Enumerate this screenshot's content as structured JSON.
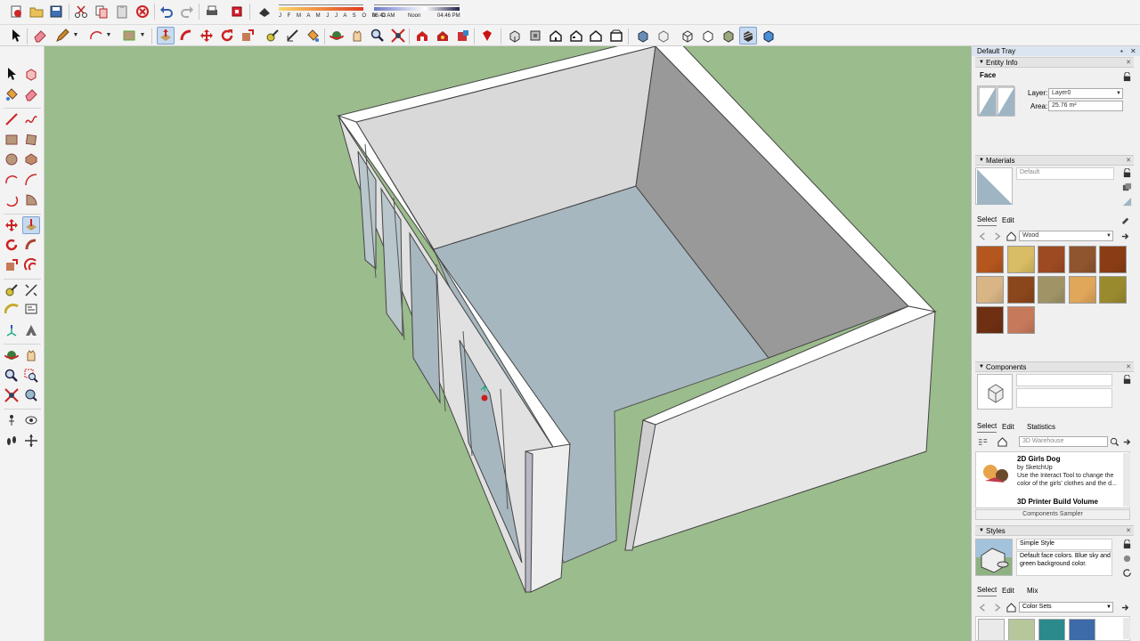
{
  "toolbar": {
    "shadow_months": "J F M A M J J A S O N D",
    "shadow_time_start": "06:42 AM",
    "shadow_time_mid": "Noon",
    "shadow_time_end": "04:46 PM"
  },
  "tray": {
    "title": "Default Tray",
    "pin_glyph": "▪",
    "close_glyph": "✕"
  },
  "entity_info": {
    "header": "Entity Info",
    "entity_type": "Face",
    "layer_label": "Layer:",
    "layer_value": "Layer0",
    "area_label": "Area:",
    "area_value": "25.76 m²"
  },
  "materials": {
    "header": "Materials",
    "current_name": "Default",
    "tab_select": "Select",
    "tab_edit": "Edit",
    "collection": "Wood",
    "swatch_colors": [
      "#b4561e",
      "#d9bc63",
      "#9d4a22",
      "#8f552e",
      "#8a3d14",
      "#d9b585",
      "#8b461c",
      "#a09467",
      "#e0a65a",
      "#9a8a2e",
      "#6f2f12",
      "#c77a5b"
    ]
  },
  "components": {
    "header": "Components",
    "tab_select": "Select",
    "tab_edit": "Edit",
    "tab_statistics": "Statistics",
    "search_placeholder": "3D Warehouse",
    "item1_title": "2D Girls Dog",
    "item1_author": "by SketchUp",
    "item1_desc": "Use the Interact Tool to change the color of the girls' clothes and the d...",
    "item2_title": "3D Printer Build Volume",
    "collection": "Components Sampler"
  },
  "styles": {
    "header": "Styles",
    "style_name": "Simple Style",
    "style_desc": "Default face colors. Blue sky and green background color.",
    "tab_select": "Select",
    "tab_edit": "Edit",
    "tab_mix": "Mix",
    "collection": "Color Sets"
  },
  "colors": {
    "background_green": "#9bbc8c",
    "floor_blue": "#a7b7bf",
    "wall_light": "#d9d9d9",
    "wall_dark": "#999999",
    "wall_top": "#ffffff",
    "selection_blue": "#c8daf0"
  }
}
